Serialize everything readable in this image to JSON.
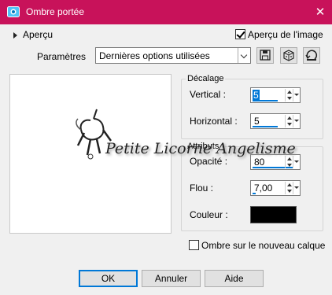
{
  "window": {
    "title": "Ombre portée"
  },
  "apercu": {
    "label": "Aperçu",
    "image_preview_label": "Aperçu de l'image",
    "image_preview_checked": true
  },
  "parametres": {
    "label": "Paramètres",
    "selected": "Dernières options utilisées"
  },
  "decalage": {
    "label": "Décalage",
    "vertical_label": "Vertical :",
    "vertical_value": "5",
    "horizontal_label": "Horizontal :",
    "horizontal_value": "5"
  },
  "attributs": {
    "label": "Attributs",
    "opacite_label": "Opacité :",
    "opacite_value": "80",
    "flou_label": "Flou :",
    "flou_value": "7,00",
    "couleur_label": "Couleur :",
    "couleur_value": "#000000"
  },
  "ombre_calque": {
    "label": "Ombre sur le nouveau calque",
    "checked": false
  },
  "buttons": {
    "ok": "OK",
    "annuler": "Annuler",
    "aide": "Aide"
  },
  "watermark": {
    "text": "Petite Licorne Angelisme"
  },
  "colors": {
    "titlebar": "#c8125a",
    "accent": "#0078d7"
  }
}
